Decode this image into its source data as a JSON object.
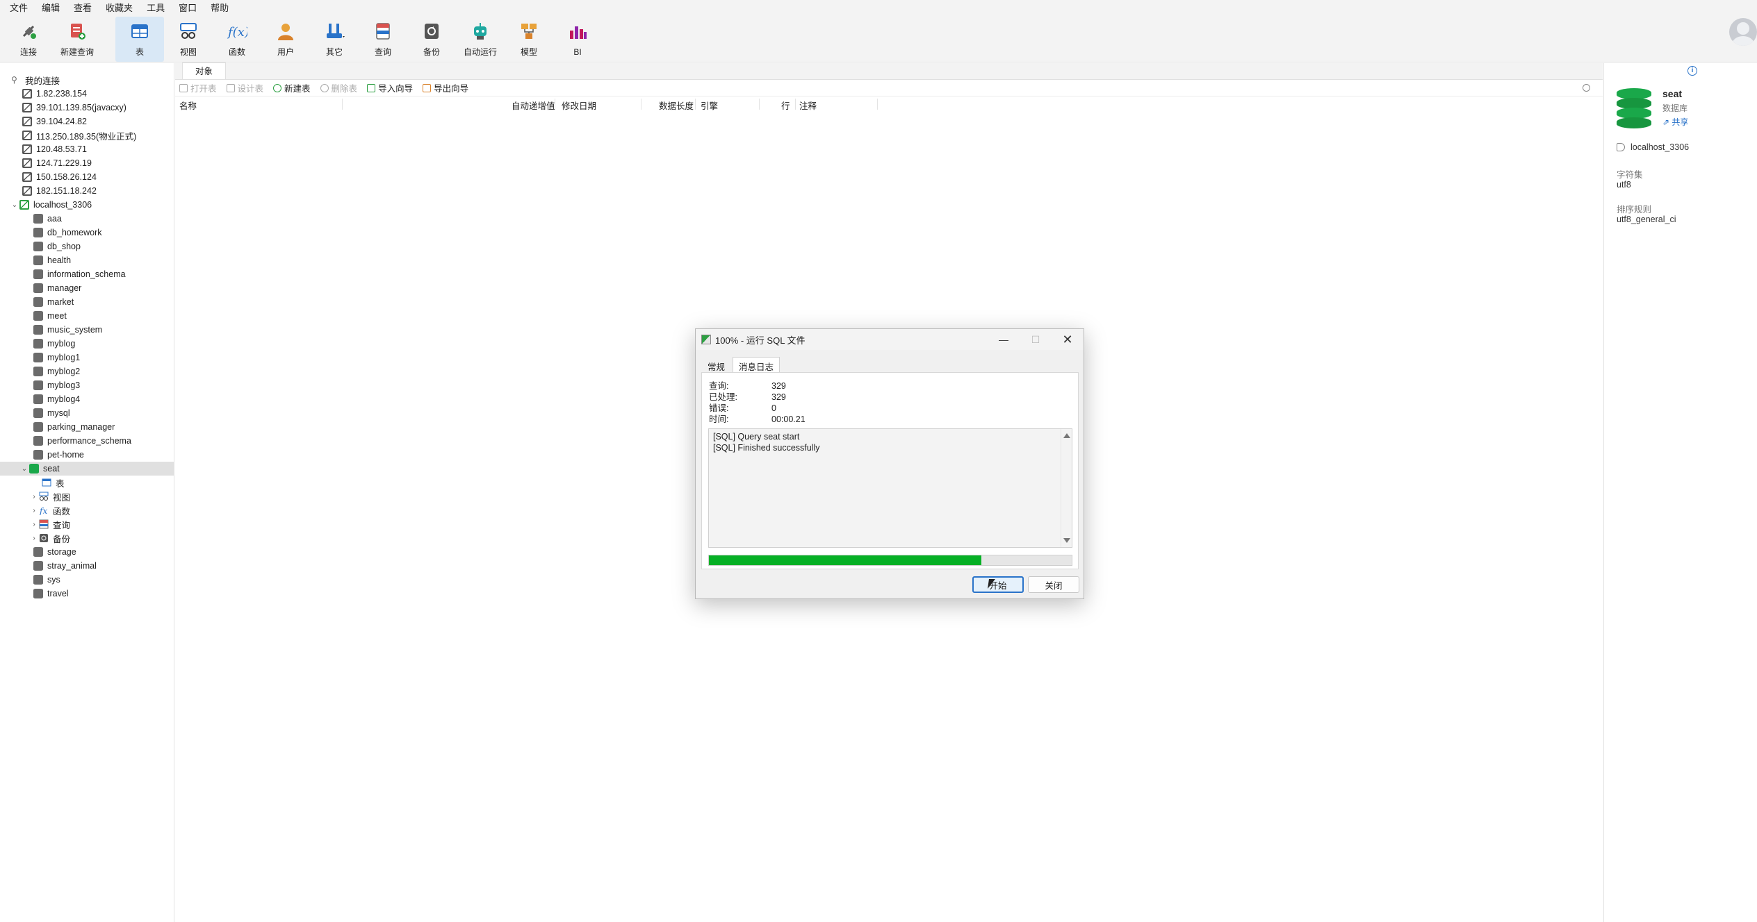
{
  "menu": [
    "文件",
    "编辑",
    "查看",
    "收藏夹",
    "工具",
    "窗口",
    "帮助"
  ],
  "toolbar": [
    {
      "label": "连接",
      "icon": "plug-icon"
    },
    {
      "label": "新建查询",
      "icon": "new-query-icon"
    },
    {
      "label": "表",
      "icon": "table-icon",
      "active": true
    },
    {
      "label": "视图",
      "icon": "view-icon"
    },
    {
      "label": "函数",
      "icon": "function-icon"
    },
    {
      "label": "用户",
      "icon": "user-icon"
    },
    {
      "label": "其它",
      "icon": "tools-icon"
    },
    {
      "label": "查询",
      "icon": "query-icon"
    },
    {
      "label": "备份",
      "icon": "backup-icon"
    },
    {
      "label": "自动运行",
      "icon": "robot-icon"
    },
    {
      "label": "模型",
      "icon": "model-icon"
    },
    {
      "label": "BI",
      "icon": "bi-chart-icon"
    }
  ],
  "sidebar": {
    "my_connections": "我的连接",
    "connections": [
      "1.82.238.154",
      "39.101.139.85(javacxy)",
      "39.104.24.82",
      "113.250.189.35(物业正式)",
      "120.48.53.71",
      "124.71.229.19",
      "150.158.26.124",
      "182.151.18.242"
    ],
    "local": "localhost_3306",
    "databases_before": [
      "aaa",
      "db_homework",
      "db_shop",
      "health",
      "information_schema",
      "manager",
      "market",
      "meet",
      "music_system",
      "myblog",
      "myblog1",
      "myblog2",
      "myblog3",
      "myblog4",
      "mysql",
      "parking_manager",
      "performance_schema",
      "pet-home"
    ],
    "selected_db": "seat",
    "seat_children": [
      "表",
      "视图",
      "函数",
      "查询",
      "备份"
    ],
    "databases_after": [
      "storage",
      "stray_animal",
      "sys",
      "travel"
    ]
  },
  "center": {
    "tab": "对象",
    "tools": {
      "open": "打开表",
      "design": "设计表",
      "new": "新建表",
      "delete": "删除表",
      "import": "导入向导",
      "export": "导出向导"
    },
    "columns": {
      "name": "名称",
      "auto_inc": "自动递增值",
      "modified": "修改日期",
      "data_len": "数据长度",
      "engine": "引擎",
      "rows": "行",
      "comment": "注释"
    }
  },
  "right": {
    "db_name": "seat",
    "db_type": "数据库",
    "share": "共享",
    "host": "localhost_3306",
    "charset_label": "字符集",
    "charset": "utf8",
    "collation_label": "排序规则",
    "collation": "utf8_general_ci"
  },
  "dialog": {
    "title": "100% - 运行 SQL 文件",
    "tabs": [
      "常规",
      "消息日志"
    ],
    "queries_label": "查询:",
    "queries": "329",
    "processed_label": "已处理:",
    "processed": "329",
    "errors_label": "错误:",
    "errors": "0",
    "time_label": "时间:",
    "time": "00:00.21",
    "log": [
      "[SQL] Query seat start",
      "[SQL] Finished successfully"
    ],
    "progress": 0.75,
    "start": "开始",
    "close": "关闭"
  },
  "colors": {
    "accent": "#2a73c9",
    "progress": "#06b025",
    "db_green": "#1aa84a"
  }
}
